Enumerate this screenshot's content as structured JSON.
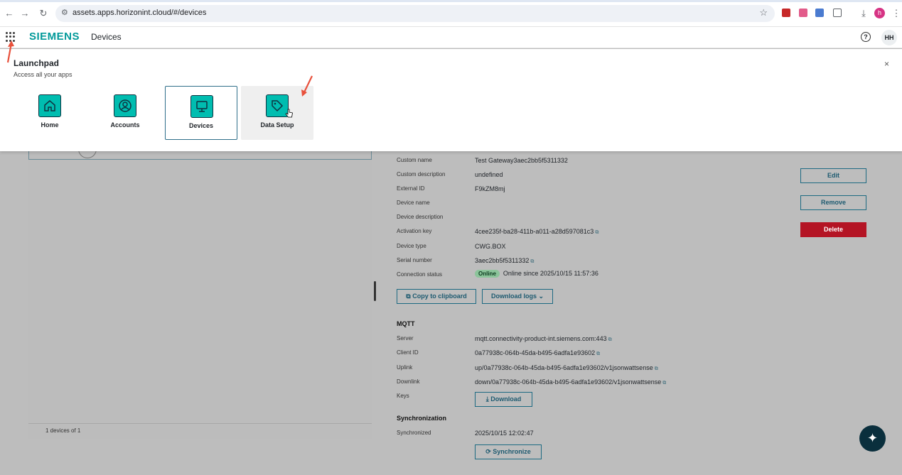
{
  "browser": {
    "url": "assets.apps.horizonint.cloud/#/devices",
    "profile_initial": "h"
  },
  "header": {
    "brand": "SIEMENS",
    "app_title": "Devices",
    "help_glyph": "?",
    "user_initials": "HH"
  },
  "launchpad": {
    "title": "Launchpad",
    "subtitle": "Access all your apps",
    "close_glyph": "×",
    "tiles": [
      {
        "label": "Home",
        "icon": "home-icon"
      },
      {
        "label": "Accounts",
        "icon": "user-circle-icon"
      },
      {
        "label": "Devices",
        "icon": "monitor-icon",
        "selected": true
      },
      {
        "label": "Data Setup",
        "icon": "tag-icon",
        "hovered": true
      }
    ]
  },
  "device_list": {
    "footer": "1 devices of 1"
  },
  "details": {
    "rows": [
      {
        "label": "Custom name",
        "value": "Test Gateway3aec2bb5f5311332"
      },
      {
        "label": "Custom description",
        "value": "undefined"
      },
      {
        "label": "External ID",
        "value": "F9kZM8mj"
      },
      {
        "label": "Device name",
        "value": ""
      },
      {
        "label": "Device description",
        "value": ""
      },
      {
        "label": "Activation key",
        "value": "4cee235f-ba28-411b-a011-a28d597081c3"
      },
      {
        "label": "Device type",
        "value": "CWG.BOX"
      },
      {
        "label": "Serial number",
        "value": "3aec2bb5f5311332"
      },
      {
        "label": "Connection status",
        "value": "Online since 2025/10/15 11:57:36"
      }
    ],
    "status_badge": "Online",
    "buttons": {
      "edit": "Edit",
      "remove": "Remove",
      "delete": "Delete",
      "copy": "Copy to clipboard",
      "download_logs": "Download logs"
    },
    "mqtt": {
      "title": "MQTT",
      "rows": [
        {
          "label": "Server",
          "value": "mqtt.connectivity-product-int.siemens.com:443"
        },
        {
          "label": "Client ID",
          "value": "0a77938c-064b-45da-b495-6adfa1e93602"
        },
        {
          "label": "Uplink",
          "value": "up/0a77938c-064b-45da-b495-6adfa1e93602/v1jsonwattsense"
        },
        {
          "label": "Downlink",
          "value": "down/0a77938c-064b-45da-b495-6adfa1e93602/v1jsonwattsense"
        }
      ],
      "keys_label": "Keys",
      "download": "Download"
    },
    "sync": {
      "title": "Synchronization",
      "label": "Synchronized",
      "value": "2025/10/15 12:02:47",
      "button": "Synchronize"
    }
  },
  "colors": {
    "brand": "#009999",
    "accent": "#00bdb0",
    "danger": "#b41424",
    "annotation_arrow": "#e8513c"
  }
}
